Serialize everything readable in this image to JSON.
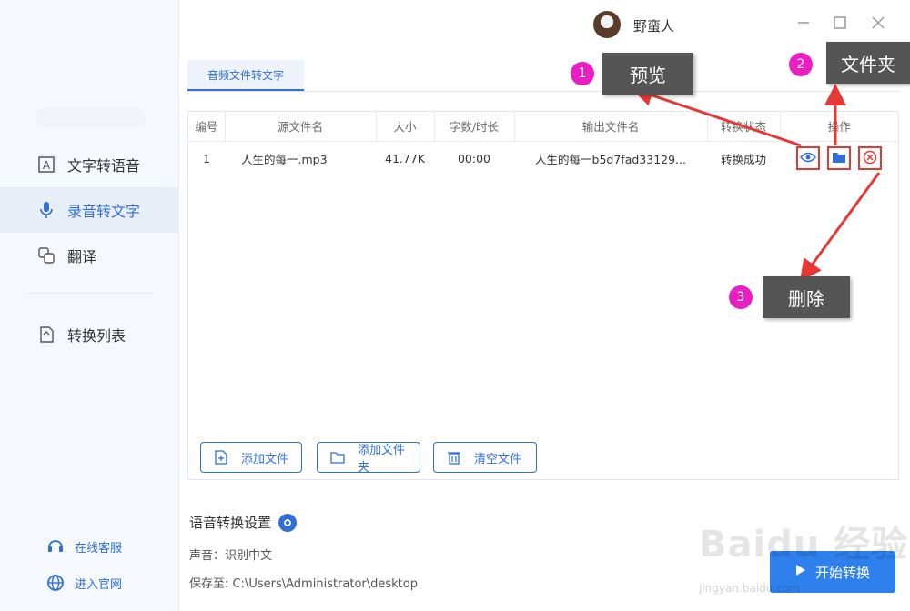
{
  "header": {
    "username": "野蛮人"
  },
  "sidebar": {
    "items": [
      {
        "label": "文字转语音"
      },
      {
        "label": "录音转文字"
      },
      {
        "label": "翻译"
      },
      {
        "label": "转换列表"
      }
    ],
    "footer": [
      {
        "label": "在线客服"
      },
      {
        "label": "进入官网"
      }
    ]
  },
  "main": {
    "tab_label": "音频文件转文字",
    "table": {
      "columns": [
        "编号",
        "源文件名",
        "大小",
        "字数/时长",
        "输出文件名",
        "转换状态",
        "操作"
      ],
      "rows": [
        {
          "id": "1",
          "source": "人生的每一.mp3",
          "size": "41.77K",
          "duration": "00:00",
          "output": "人生的每一b5d7fad33129...",
          "status": "转换成功"
        }
      ]
    },
    "buttons": {
      "add_file": "添加文件",
      "add_folder": "添加文件夹",
      "clear_files": "清空文件"
    },
    "settings": {
      "title": "语音转换设置",
      "voice": "声音：识别中文",
      "save_to": "保存至: C:\\Users\\Administrator\\desktop"
    },
    "start_button": "开始转换"
  },
  "annotations": [
    {
      "number": "1",
      "label": "预览"
    },
    {
      "number": "2",
      "label": "文件夹"
    },
    {
      "number": "3",
      "label": "删除"
    }
  ],
  "watermark": {
    "main": "Baidu 经验",
    "sub": "jingyan.baidu.com"
  },
  "colors": {
    "accent": "#2f6fd6",
    "annotation_badge": "#e91ec3",
    "annotation_box": "#555555",
    "highlight": "#e53935"
  }
}
